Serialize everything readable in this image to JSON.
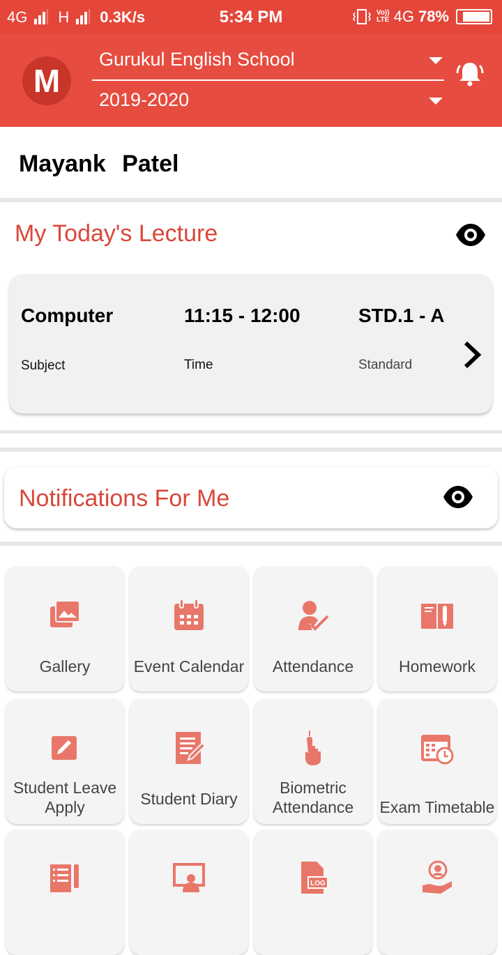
{
  "status_bar": {
    "network1": "4G",
    "network2": "H",
    "speed": "0.3K/s",
    "time": "5:34 PM",
    "volte_top": "Vo))",
    "volte_bottom": "LTE",
    "network3": "4G",
    "battery": "78%"
  },
  "header": {
    "avatar_letter": "M",
    "school": "Gurukul English School",
    "year": "2019-2020",
    "accent_color": "#e64c3f"
  },
  "user": {
    "name": "Mayank   Patel"
  },
  "lecture": {
    "title": "My Today's Lecture",
    "subject_value": "Computer",
    "subject_label": "Subject",
    "time_value": "11:15 - 12:00",
    "time_label": "Time",
    "standard_value": "STD.1 - A",
    "standard_label": "Standard"
  },
  "notifications": {
    "title": "Notifications For Me"
  },
  "tiles": [
    {
      "label": "Gallery",
      "icon": "gallery-icon"
    },
    {
      "label": "Event Calendar",
      "icon": "calendar-icon"
    },
    {
      "label": "Attendance",
      "icon": "attendance-icon"
    },
    {
      "label": "Homework",
      "icon": "homework-icon"
    },
    {
      "label": "Student Leave Apply",
      "icon": "leave-apply-icon"
    },
    {
      "label": "Student Diary",
      "icon": "diary-icon"
    },
    {
      "label": "Biometric Attendance",
      "icon": "biometric-icon"
    },
    {
      "label": "Exam Timetable",
      "icon": "exam-timetable-icon"
    },
    {
      "label": "",
      "icon": "checklist-icon"
    },
    {
      "label": "",
      "icon": "presentation-icon"
    },
    {
      "label": "",
      "icon": "log-file-icon"
    },
    {
      "label": "",
      "icon": "user-support-icon"
    }
  ]
}
